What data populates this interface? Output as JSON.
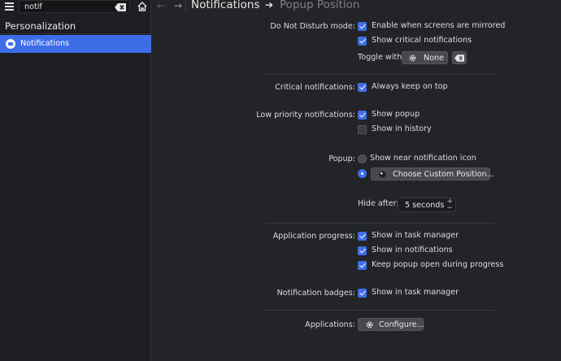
{
  "sidebar": {
    "search_value": "notif",
    "group_label": "Personalization",
    "items": [
      {
        "label": "Notifications",
        "icon": "notifications-icon"
      }
    ]
  },
  "header": {
    "crumb_parent": "Notifications",
    "crumb_current": "Popup Position"
  },
  "form": {
    "dnd": {
      "label": "Do Not Disturb mode:",
      "mirrored": "Enable when screens are mirrored",
      "critical": "Show critical notifications",
      "toggle_label": "Toggle with:",
      "toggle_value": "None"
    },
    "critical": {
      "label": "Critical notifications:",
      "keep_on_top": "Always keep on top"
    },
    "low_priority": {
      "label": "Low priority notifications:",
      "show_popup": "Show popup",
      "show_history": "Show in history"
    },
    "popup": {
      "label": "Popup:",
      "near_icon": "Show near notification icon",
      "custom_button": "Choose Custom Position...",
      "hide_label": "Hide after:",
      "hide_value": "5 seconds"
    },
    "progress": {
      "label": "Application progress:",
      "task_manager": "Show in task manager",
      "in_notifications": "Show in notifications",
      "keep_open": "Keep popup open during progress"
    },
    "badges": {
      "label": "Notification badges:",
      "task_manager": "Show in task manager"
    },
    "applications": {
      "label": "Applications:",
      "configure": "Configure..."
    }
  },
  "colors": {
    "accent": "#3d6ee8",
    "background": "#232427",
    "sidebar": "#1d1e21"
  }
}
